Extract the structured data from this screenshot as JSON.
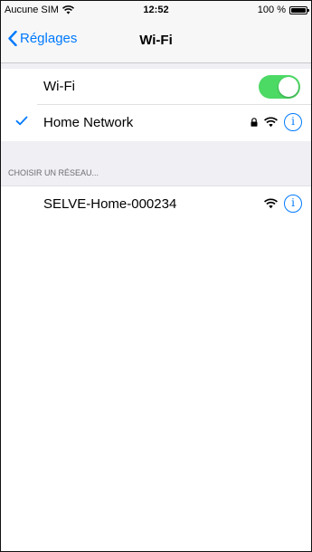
{
  "status_bar": {
    "carrier": "Aucune SIM",
    "time": "12:52",
    "battery": "100 %",
    "battery_level": 1.0
  },
  "nav": {
    "back_label": "Réglages",
    "title": "Wi-Fi"
  },
  "wifi_toggle": {
    "label": "Wi-Fi",
    "on": true,
    "on_color": "#4cd964"
  },
  "connected_network": {
    "name": "Home Network",
    "secured": true,
    "icons": [
      "checkmark-icon",
      "lock-icon",
      "wifi-icon",
      "info-icon"
    ]
  },
  "section": {
    "header": "CHOISIR UN RÉSEAU..."
  },
  "networks": [
    {
      "name": "SELVE-Home-000234",
      "secured": false,
      "icons": [
        "wifi-icon",
        "info-icon"
      ]
    }
  ],
  "colors": {
    "accent": "#007aff",
    "group_background": "#efeff4",
    "bar_background": "#f7f7f7"
  }
}
